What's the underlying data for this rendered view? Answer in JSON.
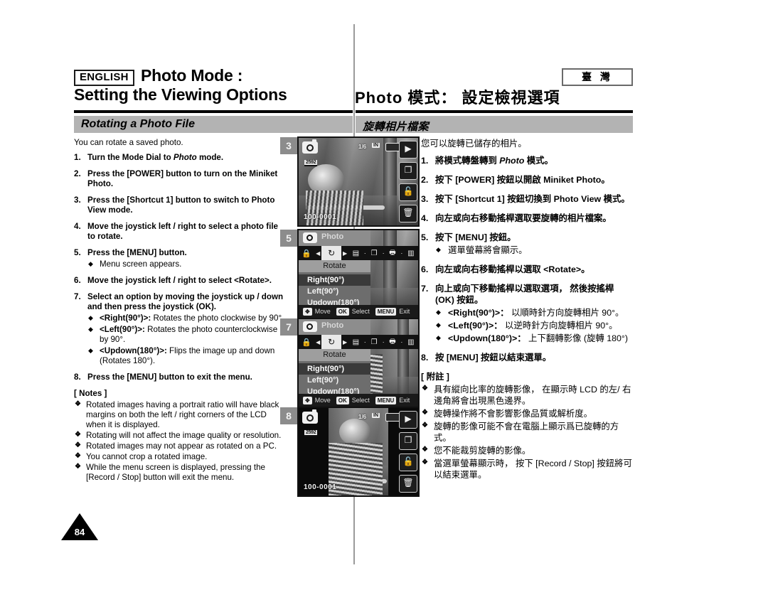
{
  "header": {
    "language_badge": "ENGLISH",
    "title_en_line1": "Photo Mode :",
    "title_en_line2": "Setting the Viewing Options",
    "region_badge": "臺 灣",
    "title_zh": "Photo 模式： 設定檢視選項",
    "section_en": "Rotating a Photo File",
    "section_zh": "旋轉相片檔案"
  },
  "en": {
    "lead": "You can rotate a saved photo.",
    "steps": [
      {
        "num": "1.",
        "pre": "Turn the Mode Dial to ",
        "italic": "Photo",
        "post": " mode."
      },
      {
        "num": "2.",
        "pre": "Press the [POWER] button to turn on the Miniket Photo.",
        "italic": "",
        "post": ""
      },
      {
        "num": "3.",
        "pre": "Press the [Shortcut 1] button to switch to Photo View mode.",
        "italic": "",
        "post": ""
      },
      {
        "num": "4.",
        "pre": "Move the joystick left / right to select a photo file to rotate.",
        "italic": "",
        "post": ""
      },
      {
        "num": "5.",
        "pre": "Press the [MENU] button.",
        "italic": "",
        "post": ""
      },
      {
        "num": "6.",
        "pre": "Move the joystick left / right to select <Rotate>.",
        "italic": "",
        "post": ""
      },
      {
        "num": "7.",
        "pre": "Select an option by moving the joystick up / down and then press the joystick (OK).",
        "italic": "",
        "post": ""
      },
      {
        "num": "8.",
        "pre": "Press the [MENU] button to exit the menu.",
        "italic": "",
        "post": ""
      }
    ],
    "sub_step5": "Menu screen appears.",
    "sub_step7": [
      {
        "bold": "<Right(90°)>:",
        "rest": " Rotates the photo clockwise by 90°."
      },
      {
        "bold": "<Left(90°)>:",
        "rest": " Rotates the photo counterclockwise by 90°."
      },
      {
        "bold": "<Updown(180°)>:",
        "rest": " Flips the image up and down (Rotates 180°)."
      }
    ],
    "notes_title": "[ Notes ]",
    "notes": [
      "Rotated images having a portrait ratio will have black margins on both the left / right corners of the LCD when it is displayed.",
      "Rotating will not affect the image quality or resolution.",
      "Rotated images may not appear as rotated on a PC.",
      "You cannot crop a rotated image.",
      "While the menu screen is displayed, pressing the [Record / Stop] button will exit the menu."
    ]
  },
  "zh": {
    "lead": "您可以旋轉已儲存的相片。",
    "steps": [
      {
        "num": "1.",
        "pre": "將模式轉盤轉到 ",
        "italic": "Photo",
        "post": " 模式。"
      },
      {
        "num": "2.",
        "pre": "按下 [POWER] 按鈕以開啟 Miniket Photo。",
        "italic": "",
        "post": ""
      },
      {
        "num": "3.",
        "pre": "按下 [Shortcut 1] 按鈕切換到 Photo View 模式。",
        "italic": "",
        "post": ""
      },
      {
        "num": "4.",
        "pre": "向左或向右移動搖桿選取要旋轉的相片檔案。",
        "italic": "",
        "post": ""
      },
      {
        "num": "5.",
        "pre": "按下 [MENU] 按鈕。",
        "italic": "",
        "post": ""
      },
      {
        "num": "6.",
        "pre": "向左或向右移動搖桿以選取 <Rotate>。",
        "italic": "",
        "post": ""
      },
      {
        "num": "7.",
        "pre": "向上或向下移動搖桿以選取選項， 然後按搖桿 (OK) 按鈕。",
        "italic": "",
        "post": ""
      },
      {
        "num": "8.",
        "pre": "按 [MENU] 按鈕以結束選單。",
        "italic": "",
        "post": ""
      }
    ],
    "sub_step5": "選單螢幕將會顯示。",
    "sub_step7": [
      {
        "bold": "<Right(90°)>：",
        "rest": " 以順時針方向旋轉相片 90°。"
      },
      {
        "bold": "<Left(90°)>：",
        "rest": " 以逆時針方向旋轉相片 90°。"
      },
      {
        "bold": "<Updown(180°)>：",
        "rest": " 上下翻轉影像 (旋轉 180°)"
      }
    ],
    "notes_title": "[ 附註 ]",
    "notes": [
      "具有縱向比率的旋轉影像， 在顯示時 LCD 的左/ 右邊角將會出現黑色邊界。",
      "旋轉操作將不會影響影像品質或解析度。",
      "旋轉的影像可能不會在電腦上顯示爲已旋轉的方式。",
      "您不能裁剪旋轉的影像。",
      "當選單螢幕顯示時， 按下 [Record / Stop] 按鈕將可以結束選單。"
    ]
  },
  "markers": {
    "m3": "3",
    "m5": "5",
    "m7": "7",
    "m8": "8"
  },
  "lcd_view": {
    "resolution": "2592",
    "counter": "1/6",
    "memory": "IN",
    "file_number": "100-0001"
  },
  "lcd_menu": {
    "mode_label": "Photo",
    "title": "Rotate",
    "options": [
      "Right(90°)",
      "Left(90°)",
      "Updown(180°)"
    ],
    "selected": "Right(90°)",
    "key_move": "Move",
    "key_ok": "OK",
    "key_select": "Select",
    "key_menu": "MENU",
    "key_exit": "Exit"
  },
  "page_number": "84",
  "colors": {
    "section_bar": "#b3b3b3",
    "marker": "#8c8c8c",
    "rule": "#000000"
  }
}
